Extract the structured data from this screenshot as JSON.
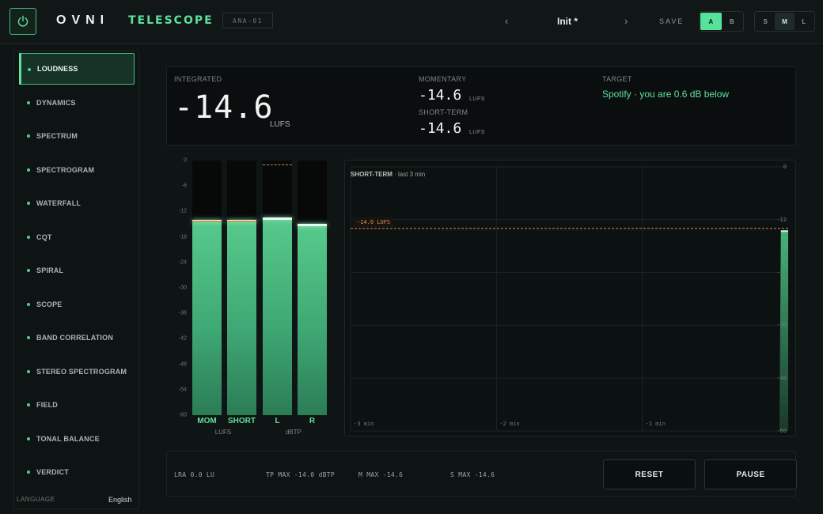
{
  "header": {
    "brand": "OVNI",
    "product": "TELESCOPE",
    "version": "ANA-01",
    "preset_prev": "‹",
    "preset_name": "Init *",
    "preset_next": "›",
    "save_label": "SAVE",
    "ab": [
      {
        "label": "A",
        "active": true
      },
      {
        "label": "B",
        "active": false
      }
    ],
    "sml": [
      {
        "label": "S",
        "active": false
      },
      {
        "label": "M",
        "active": true
      },
      {
        "label": "L",
        "active": false
      }
    ],
    "power_icon": "power-icon",
    "accent_color": "#5fe09a"
  },
  "sidebar": {
    "items": [
      {
        "label": "LOUDNESS",
        "active": true
      },
      {
        "label": "DYNAMICS"
      },
      {
        "label": "SPECTRUM"
      },
      {
        "label": "SPECTROGRAM"
      },
      {
        "label": "WATERFALL"
      },
      {
        "label": "CQT"
      },
      {
        "label": "SPIRAL"
      },
      {
        "label": "SCOPE"
      },
      {
        "label": "BAND CORRELATION"
      },
      {
        "label": "STEREO SPECTROGRAM"
      },
      {
        "label": "FIELD"
      },
      {
        "label": "TONAL BALANCE"
      },
      {
        "label": "VERDICT"
      }
    ],
    "language_label": "LANGUAGE",
    "language_value": "English"
  },
  "readout": {
    "integrated_label": "INTEGRATED",
    "integrated_value": "-14.6",
    "integrated_unit": "LUFS",
    "momentary_label": "MOMENTARY",
    "momentary_value": "-14.6",
    "momentary_unit": "LUFS",
    "shortterm_label": "SHORT-TERM",
    "shortterm_value": "-14.6",
    "shortterm_unit": "LUFS",
    "target_label": "TARGET",
    "target_text": "Spotify · you are 0.6 dB below"
  },
  "meters": {
    "scale": [
      "0",
      "-6",
      "-12",
      "-18",
      "-24",
      "-30",
      "-36",
      "-42",
      "-48",
      "-54",
      "-60"
    ],
    "range": [
      -60,
      0
    ],
    "bars": [
      {
        "label": "MOM",
        "level_db": -14.6,
        "peak_db": -14.1,
        "peak_style": "solid"
      },
      {
        "label": "SHORT",
        "level_db": -14.6,
        "peak_db": -14.1,
        "peak_style": "solid"
      },
      {
        "label": "L",
        "level_db": -14.0,
        "peak_db": -1.0,
        "peak_style": "dashed"
      },
      {
        "label": "R",
        "level_db": -15.4,
        "peak_db": null,
        "peak_style": "none"
      }
    ],
    "group_lufs": "LUFS",
    "group_dbtp": "dBTP"
  },
  "chart_data": {
    "type": "area",
    "title": "SHORT-TERM",
    "subtitle": "last 3 min",
    "x_ticks": [
      "-3 min",
      "-2 min",
      "-1 min"
    ],
    "y_ticks": [
      "0",
      "-12",
      "-24",
      "-36",
      "-48",
      "-60"
    ],
    "ylim": [
      -60,
      0
    ],
    "xlim": [
      -3,
      0
    ],
    "target_label": "-14.0 LUFS",
    "target_value": -14.0,
    "series": [
      {
        "x": [
          -0.06,
          -0.05,
          0.0
        ],
        "values": [
          -60,
          -14.6,
          -14.6
        ]
      }
    ]
  },
  "stats": {
    "lra": "LRA 0.0 LU",
    "tp_max": "TP MAX -14.0 dBTP",
    "m_max": "M MAX -14.6",
    "s_max": "S MAX -14.6",
    "reset_label": "RESET",
    "pause_label": "PAUSE"
  }
}
